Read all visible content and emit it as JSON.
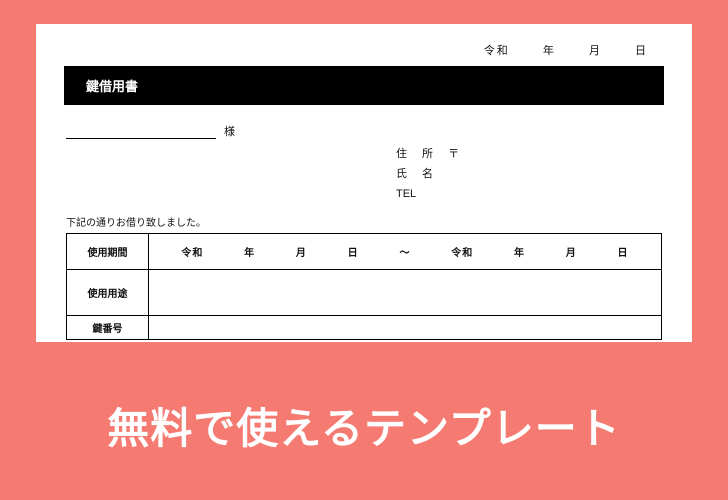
{
  "date_header": {
    "era": "令和",
    "year_label": "年",
    "month_label": "月",
    "day_label": "日"
  },
  "title": "鍵借用書",
  "recipient_suffix": "様",
  "contact": {
    "address_label": "住 所",
    "postal_mark": "〒",
    "name_label": "氏 名",
    "tel_label": "TEL"
  },
  "note": "下記の通りお借り致しました。",
  "table": {
    "period_label": "使用期間",
    "purpose_label": "使用用途",
    "keyno_label": "鍵番号",
    "period_cells": {
      "era1": "令和",
      "year1": "年",
      "month1": "月",
      "day1": "日",
      "tilde": "〜",
      "era2": "令和",
      "year2": "年",
      "month2": "月",
      "day2": "日"
    }
  },
  "banner": "無料で使えるテンプレート"
}
